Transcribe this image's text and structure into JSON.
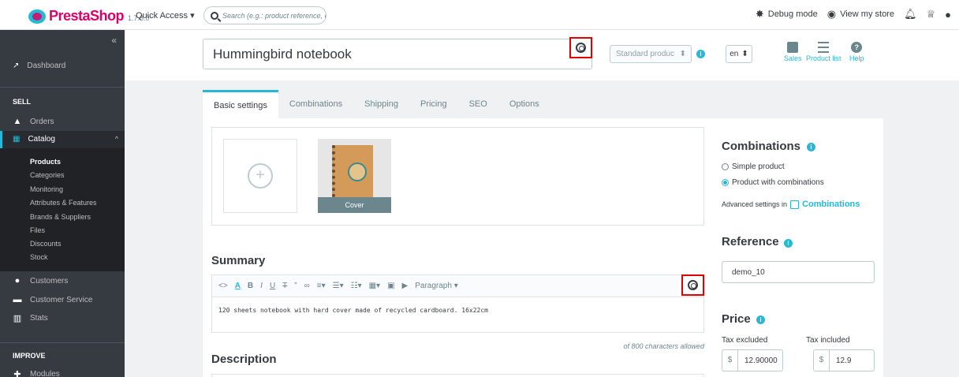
{
  "header": {
    "brand": "PrestaShop",
    "version": "1.7.8.0",
    "quick_access": "Quick Access ▾",
    "search_placeholder": "Search (e.g.: product reference, custon",
    "debug_mode": "Debug mode",
    "view_store": "View my store"
  },
  "sidebar": {
    "dashboard": "Dashboard",
    "sell": "SELL",
    "orders": "Orders",
    "catalog": "Catalog",
    "catalog_items": [
      "Products",
      "Categories",
      "Monitoring",
      "Attributes & Features",
      "Brands & Suppliers",
      "Files",
      "Discounts",
      "Stock"
    ],
    "customers": "Customers",
    "customer_service": "Customer Service",
    "stats": "Stats",
    "improve": "IMPROVE",
    "modules": "Modules"
  },
  "product": {
    "name": "Hummingbird notebook",
    "type": "Standard produc",
    "lang": "en",
    "tools": {
      "sales": "Sales",
      "list": "Product list",
      "help": "Help"
    }
  },
  "tabs": [
    "Basic settings",
    "Combinations",
    "Shipping",
    "Pricing",
    "SEO",
    "Options"
  ],
  "images": {
    "cover_label": "Cover"
  },
  "summary": {
    "title": "Summary",
    "paragraph": "Paragraph ▾",
    "text": "120 sheets notebook with hard cover made of recycled cardboard. 16x22cm",
    "counter": "of 800 characters allowed"
  },
  "description": {
    "title": "Description"
  },
  "combinations": {
    "title": "Combinations",
    "simple": "Simple product",
    "with_combinations": "Product with combinations",
    "advanced": "Advanced settings in",
    "advanced_link": "Combinations"
  },
  "reference": {
    "title": "Reference",
    "value": "demo_10"
  },
  "price": {
    "title": "Price",
    "tax_excluded": "Tax excluded",
    "tax_included": "Tax included",
    "currency": "$",
    "excl_value": "12.90000",
    "incl_value": "12.9"
  },
  "colors": {
    "accent": "#25b9d7",
    "brand": "#df0067",
    "sidebar": "#363a41",
    "highlight": "#e10000"
  }
}
